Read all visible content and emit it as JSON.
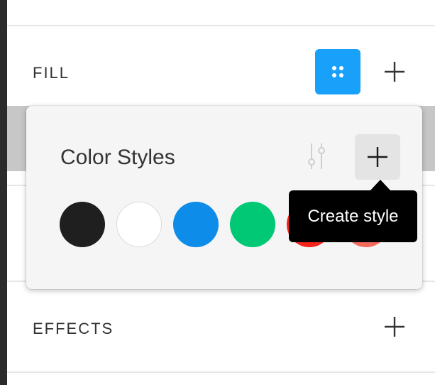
{
  "sections": {
    "fill": {
      "title": "FILL",
      "style_toggle_icon": "styles-grid-icon",
      "add_icon": "plus-icon"
    },
    "effects": {
      "title": "EFFECTS",
      "add_icon": "plus-icon"
    }
  },
  "popover": {
    "title": "Color Styles",
    "settings_icon": "adjust-sliders-icon",
    "create_icon": "plus-icon",
    "tooltip": "Create style",
    "swatches": [
      {
        "name": "black",
        "color": "#1f1f1f"
      },
      {
        "name": "white",
        "color": "#ffffff"
      },
      {
        "name": "blue",
        "color": "#0d8ce9"
      },
      {
        "name": "green",
        "color": "#00c875"
      },
      {
        "name": "red",
        "color": "#f5241b"
      },
      {
        "name": "salmon",
        "color": "#f26b5b"
      }
    ]
  },
  "colors": {
    "accent": "#18a0fb",
    "tooltip_bg": "#000000",
    "popover_bg": "#f5f5f5"
  }
}
